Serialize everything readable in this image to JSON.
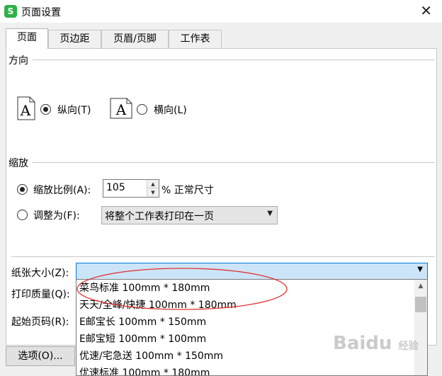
{
  "window": {
    "title": "页面设置",
    "app_icon_letter": "S"
  },
  "tabs": [
    {
      "label": "页面"
    },
    {
      "label": "页边距"
    },
    {
      "label": "页眉/页脚"
    },
    {
      "label": "工作表"
    }
  ],
  "orientation": {
    "group_label": "方向",
    "portrait_label": "纵向(T)",
    "landscape_label": "横向(L)",
    "portrait_icon_letter": "A",
    "landscape_icon_letter": "A",
    "selected": "portrait"
  },
  "scaling": {
    "group_label": "缩放",
    "scale_label": "缩放比例(A):",
    "scale_value": "105",
    "scale_suffix": "% 正常尺寸",
    "fit_label": "调整为(F):",
    "fit_value": "将整个工作表打印在一页",
    "selected": "scale"
  },
  "paper": {
    "size_label": "纸张大小(Z):",
    "quality_label": "打印质量(Q):",
    "first_page_label": "起始页码(R):"
  },
  "dropdown": {
    "items": [
      "菜鸟标准 100mm * 180mm",
      "天天/全峰/快捷 100mm * 180mm",
      "E邮宝长 100mm * 150mm",
      "E邮宝短 100mm * 100mm",
      "优速/宅急送 100mm * 150mm",
      "优速标准 100mm * 180mm"
    ]
  },
  "buttons": {
    "options_label": "选项(O)..."
  },
  "watermark": {
    "brand": "Baidu",
    "sub": "经验"
  },
  "colors": {
    "accent": "#0078d7",
    "annotation": "#e03030",
    "app_icon": "#2fb14a"
  }
}
